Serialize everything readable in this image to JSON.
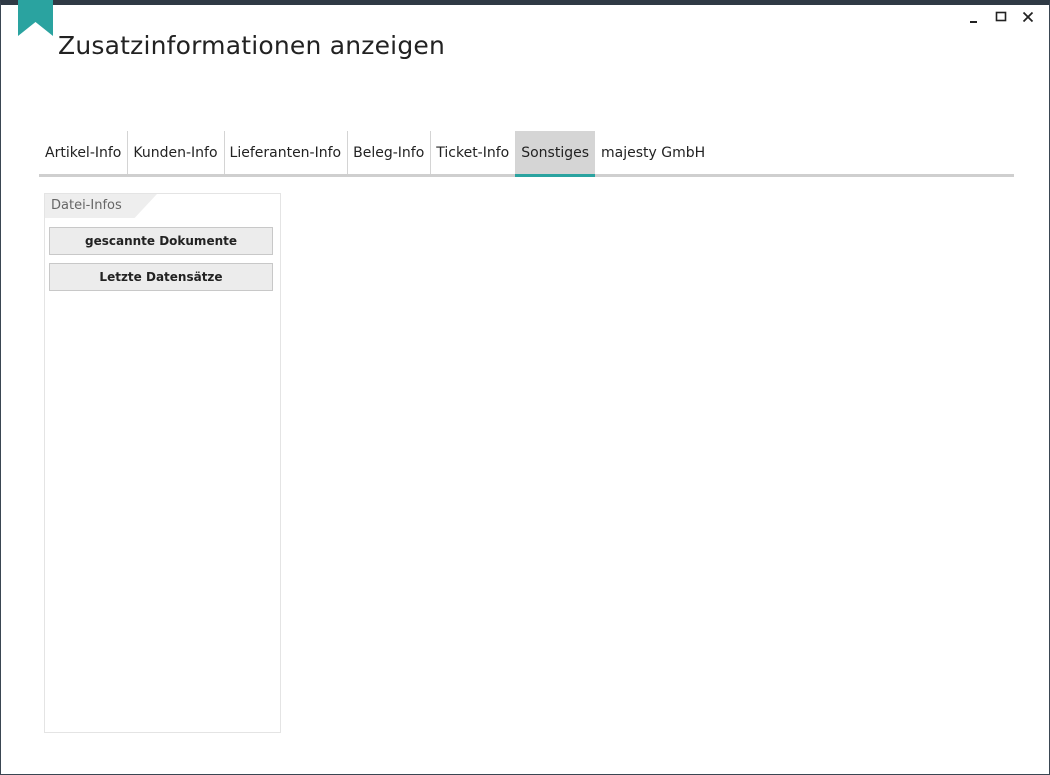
{
  "window": {
    "title": "Zusatzinformationen anzeigen",
    "accent_color": "#2aa3a0",
    "controls": [
      "minimize",
      "maximize",
      "close"
    ]
  },
  "tabs": [
    {
      "label": "Artikel-Info",
      "active": false
    },
    {
      "label": "Kunden-Info",
      "active": false
    },
    {
      "label": "Lieferanten-Info",
      "active": false
    },
    {
      "label": "Beleg-Info",
      "active": false
    },
    {
      "label": "Ticket-Info",
      "active": false
    },
    {
      "label": "Sonstiges",
      "active": true
    },
    {
      "label": "majesty GmbH",
      "active": false
    }
  ],
  "panel": {
    "header": "Datei-Infos",
    "buttons": [
      {
        "label": "gescannte Dokumente"
      },
      {
        "label": "Letzte Datensätze"
      }
    ]
  }
}
